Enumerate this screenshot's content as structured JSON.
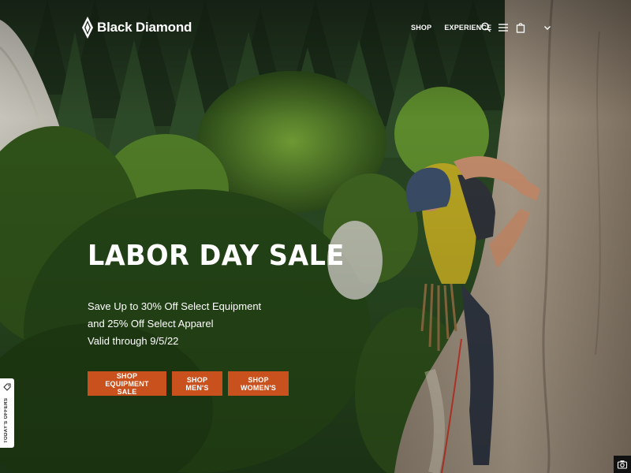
{
  "brand": {
    "name": "Black Diamond",
    "accent": "#c8511e"
  },
  "nav": {
    "shop_label": "SHOP",
    "experience_label": "EXPERIENCE",
    "icons": [
      "search-icon",
      "menu-icon",
      "cart-icon",
      "chevron-down-icon"
    ]
  },
  "hero": {
    "headline": "LABOR DAY SALE",
    "lines": [
      "Save Up to 30% Off Select Equipment",
      "and 25% Off Select Apparel",
      "Valid through 9/5/22"
    ],
    "buttons": {
      "equipment": "SHOP EQUIPMENT SALE",
      "men": "SHOP MEN'S",
      "women": "SHOP WOMEN'S"
    }
  },
  "side_tab": {
    "label": "TODAY'S OFFERS",
    "icon": "tag-icon"
  },
  "corner": {
    "icon": "camera-icon"
  }
}
